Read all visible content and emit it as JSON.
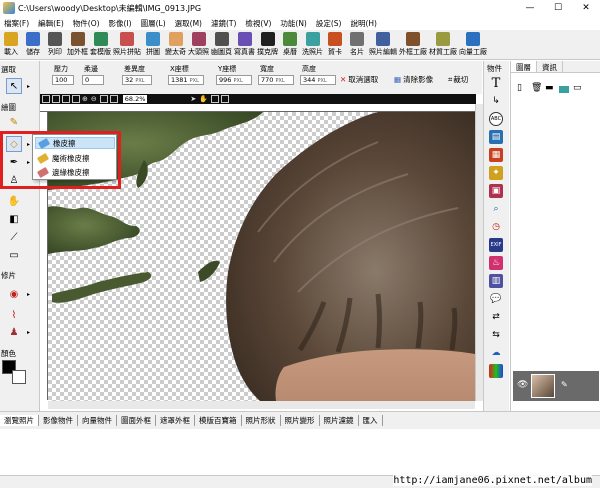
{
  "window": {
    "title": "C:\\Users\\woody\\Desktop\\未編輯\\IMG_0913.JPG",
    "minimize": "—",
    "maximize": "☐",
    "close": "✕"
  },
  "menu": [
    "檔案(F)",
    "編輯(E)",
    "物件(O)",
    "影像(I)",
    "圖層(L)",
    "選取(M)",
    "濾鏡(T)",
    "檢視(V)",
    "功能(N)",
    "設定(S)",
    "說明(H)"
  ],
  "toolbar": [
    {
      "label": "載入",
      "color": "#d9a520"
    },
    {
      "label": "儲存",
      "color": "#3a6ec8"
    },
    {
      "label": "列印",
      "color": "#555555"
    },
    {
      "label": "加外框",
      "color": "#7a5230"
    },
    {
      "label": "套模版",
      "color": "#2e8b57"
    },
    {
      "label": "照片拼貼",
      "color": "#c94f4f"
    },
    {
      "label": "拼圖",
      "color": "#3b8fc9"
    },
    {
      "label": "變太奇",
      "color": "#e0a060"
    },
    {
      "label": "大頭照",
      "color": "#a04060"
    },
    {
      "label": "幽圖頁",
      "color": "#505050"
    },
    {
      "label": "寫真書",
      "color": "#6a4fb5"
    },
    {
      "label": "撲克牌",
      "color": "#202020"
    },
    {
      "label": "桌曆",
      "color": "#4a8a3a"
    },
    {
      "label": "洗照片",
      "color": "#3aa0a0"
    },
    {
      "label": "賀卡",
      "color": "#c85020"
    },
    {
      "label": "名片",
      "color": "#707070"
    },
    {
      "label": "照片編輯",
      "color": "#4060a0"
    },
    {
      "label": "外框工廠",
      "color": "#80502a"
    },
    {
      "label": "材質工廠",
      "color": "#9a9a40"
    },
    {
      "label": "向量工廠",
      "color": "#2a70c0"
    }
  ],
  "left_tools": {
    "select_label": "選取",
    "draw_label": "繪圖",
    "fix_label": "修片",
    "color_label": "顏色",
    "fg_color": "#000000",
    "bg_color": "#ffffff"
  },
  "properties": {
    "pressure_label": "壓力",
    "pressure_value": "100",
    "softness_label": "柔邊",
    "softness_value": "0",
    "tolerance_label": "差異度",
    "tolerance_value": "32",
    "x_label": "X座標",
    "x_value": "1381",
    "y_label": "Y座標",
    "y_value": "996",
    "width_label": "寬度",
    "width_value": "770",
    "height_label": "高度",
    "height_value": "344",
    "unit": "PXL",
    "cancel_select": "取消選取",
    "clear_image": "清除影像",
    "crop": "裁切"
  },
  "canvas_toolbar": {
    "zoom": "68.2%"
  },
  "eraser_menu": {
    "items": [
      "橡皮擦",
      "魔術橡皮擦",
      "邊緣橡皮擦"
    ],
    "highlighted": "橡皮擦"
  },
  "object_bar": {
    "label": "物件"
  },
  "right_panel": {
    "tab_layers": "圖層",
    "tab_info": "資訊"
  },
  "bottom_tabs": [
    "瀏覽照片",
    "影像物件",
    "向量物件",
    "圖面外框",
    "遮罩外框",
    "模版百寶箱",
    "照片形狀",
    "照片變形",
    "照片濾鏡",
    "匯入"
  ],
  "status": {
    "watermark": "http://iamjane06.pixnet.net/album"
  }
}
